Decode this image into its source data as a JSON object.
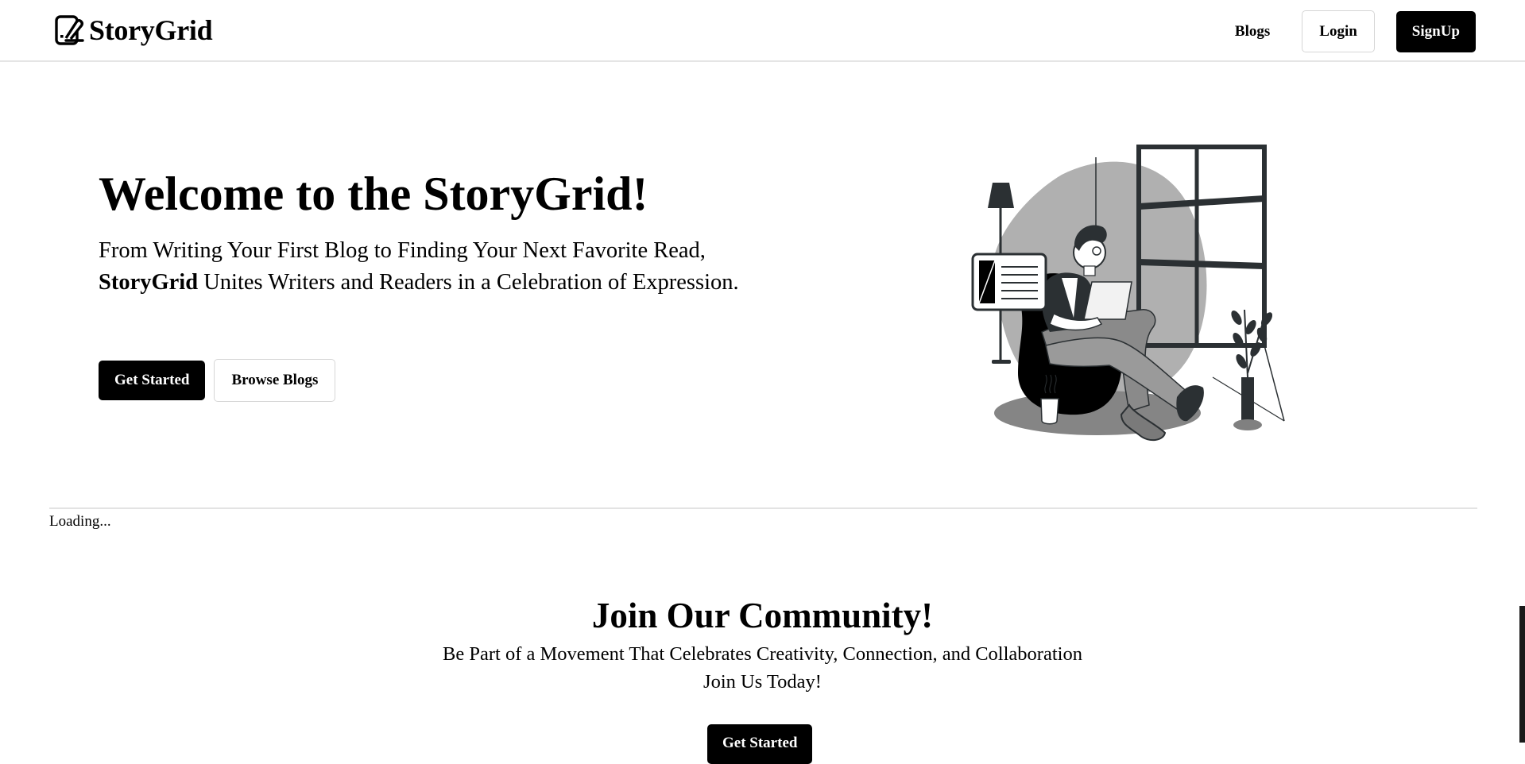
{
  "navbar": {
    "brand_name": "StoryGrid",
    "brand_icon": "storygrid-logo-icon",
    "blogs_link": "Blogs",
    "login_label": "Login",
    "signup_label": "SignUp"
  },
  "hero": {
    "title": "Welcome to the StoryGrid!",
    "subtitle_part1": "From Writing Your First Blog to Finding Your Next Favorite Read,",
    "subtitle_brand": "StoryGrid",
    "subtitle_part2": "Unites Writers and Readers in a Celebration of Expression.",
    "get_started_label": "Get Started",
    "browse_blogs_label": "Browse Blogs",
    "illustration": "person-reading-laptop-illustration"
  },
  "status": {
    "loading_text": "Loading..."
  },
  "community": {
    "title": "Join Our Community!",
    "subtitle_line1": "Be Part of a Movement That Celebrates Creativity, Connection, and Collaboration",
    "subtitle_line2": "Join Us Today!",
    "cta_label": "Get Started"
  },
  "colors": {
    "primary": "#000000",
    "background": "#ffffff",
    "border": "#d6d6d6",
    "illustration_gray": "#b0b0b0",
    "illustration_dark": "#2b3033"
  }
}
